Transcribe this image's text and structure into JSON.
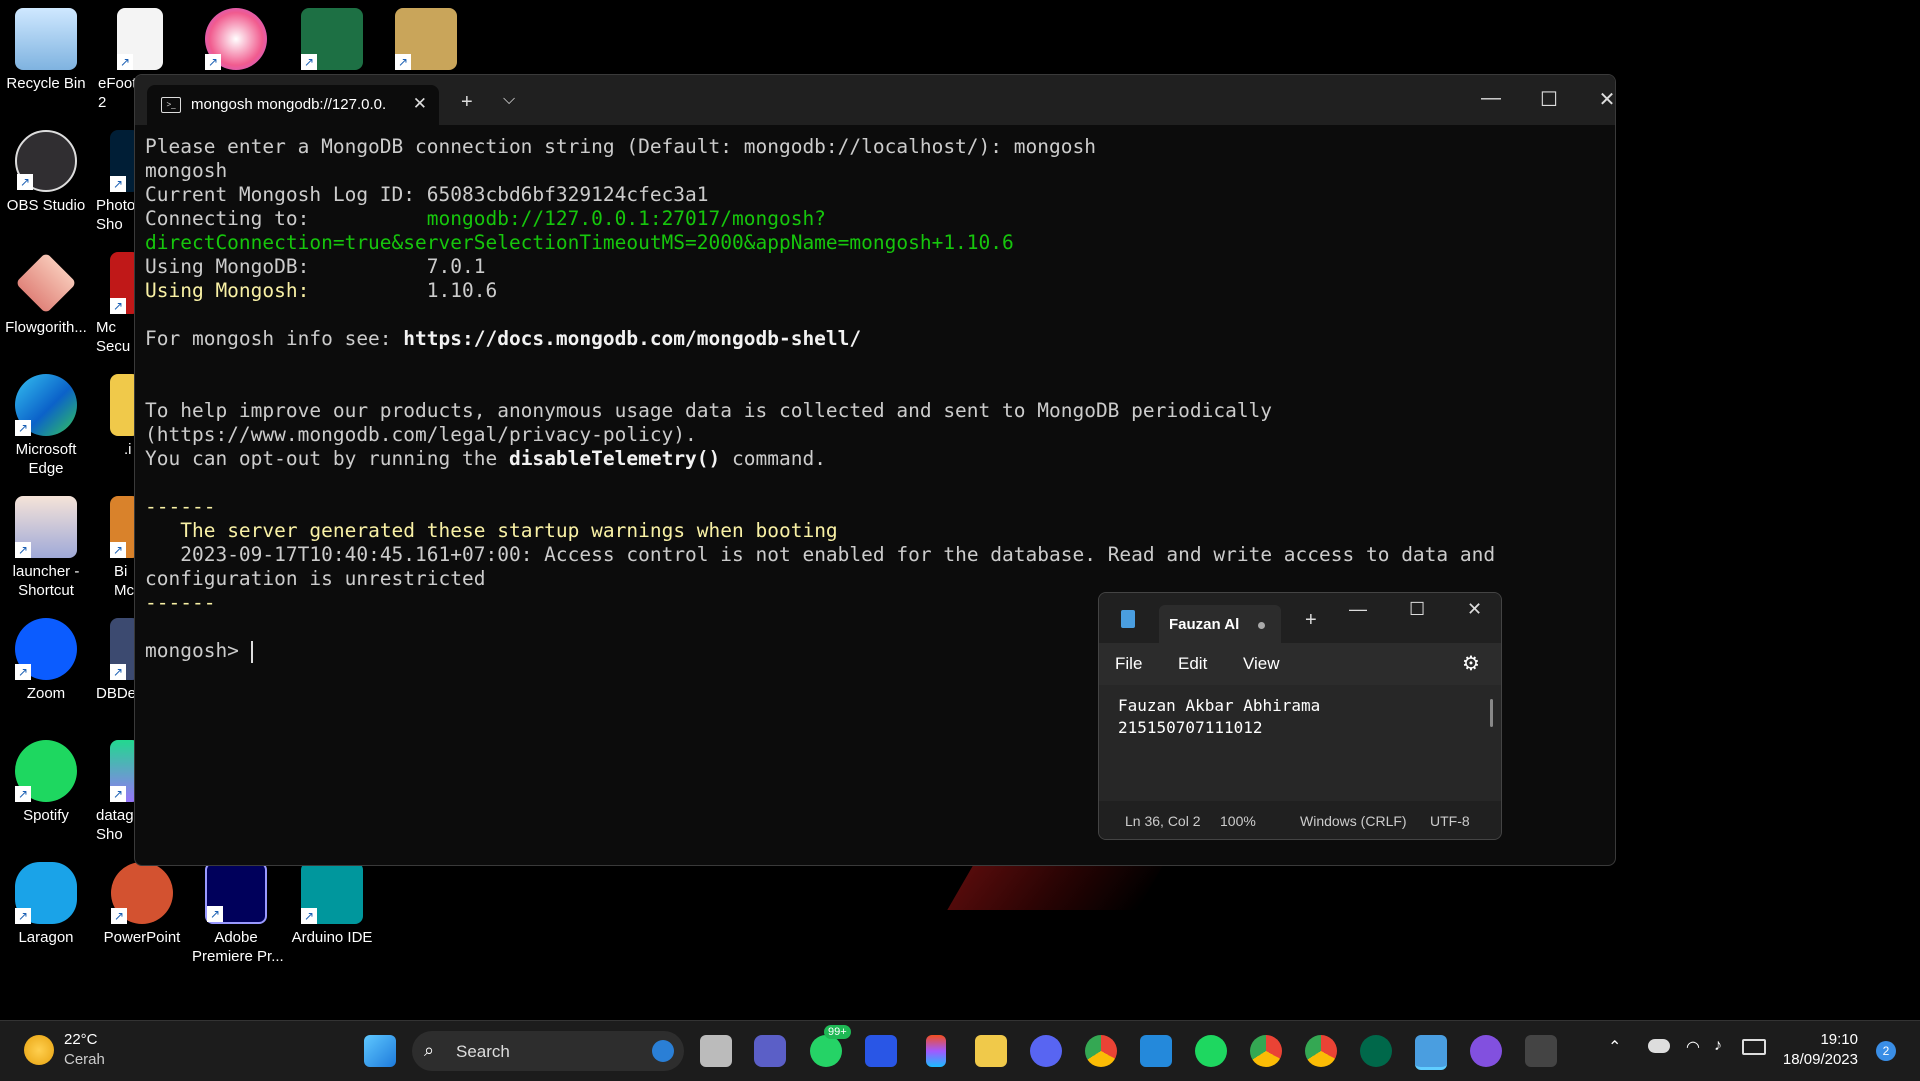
{
  "desktop_icons": [
    {
      "label": "Recycle Bin",
      "icon": "recycle-bin-icon"
    },
    {
      "label": "eFootl\n2",
      "icon": "file-icon"
    },
    {
      "label": "",
      "icon": "itunes-icon"
    },
    {
      "label": "",
      "icon": "excel-icon"
    },
    {
      "label": "",
      "icon": "network-search-icon"
    },
    {
      "label": "OBS Studio",
      "icon": "obs-icon"
    },
    {
      "label": "Photo\nSho",
      "icon": "photoshop-icon"
    },
    {
      "label": "Flowgorith...",
      "icon": "flowgorithm-icon"
    },
    {
      "label": "Mc\nSecu",
      "icon": "mcafee-icon"
    },
    {
      "label": "Microsoft\nEdge",
      "icon": "edge-icon"
    },
    {
      "label": ".i",
      "icon": "folder-icon"
    },
    {
      "label": "launcher -\nShortcut",
      "icon": "launcher-icon"
    },
    {
      "label": "Bi\nMc",
      "icon": "app-icon"
    },
    {
      "label": "Zoom",
      "icon": "zoom-icon"
    },
    {
      "label": "DBDe",
      "icon": "dbdesigner-icon"
    },
    {
      "label": "Spotify",
      "icon": "spotify-icon"
    },
    {
      "label": "datag\nSho",
      "icon": "datagrip-icon"
    },
    {
      "label": "Laragon",
      "icon": "laragon-icon"
    },
    {
      "label": "PowerPoint",
      "icon": "powerpoint-icon"
    },
    {
      "label": "Adobe\nPremiere Pr...",
      "icon": "premiere-icon"
    },
    {
      "label": "Arduino IDE",
      "icon": "arduino-icon"
    }
  ],
  "terminal": {
    "tab_title": "mongosh mongodb://127.0.0.",
    "new_tab": "+",
    "dropdown": "⌵",
    "minimize": "—",
    "maximize": "☐",
    "close": "✕",
    "lines": {
      "l1": "Please enter a MongoDB connection string (Default: mongodb://localhost/): mongosh",
      "l2": "mongosh",
      "l3": "Current Mongosh Log ID: 65083cbd6bf329124cfec3a1",
      "l4_label": "Connecting to:          ",
      "l4_url": "mongodb://127.0.0.1:27017/mongosh?directConnection=true&serverSelectionTimeoutMS=2000&appName=mongosh+1.10.6",
      "l5_label": "Using MongoDB:          ",
      "l5_val": "7.0.1",
      "l6_label": "Using Mongosh:",
      "l6_val": "          1.10.6",
      "l7_prefix": "For mongosh info see: ",
      "l7_link": "https://docs.mongodb.com/mongodb-shell/",
      "l8": "To help improve our products, anonymous usage data is collected and sent to MongoDB periodically (https://www.mongodb.com/legal/privacy-policy).",
      "l9_prefix": "You can opt-out by running the ",
      "l9_cmd": "disableTelemetry()",
      "l9_suffix": " command.",
      "sep": "------",
      "warn_title": "   The server generated these startup warnings when booting",
      "warn_body": "   2023-09-17T10:40:45.161+07:00: Access control is not enabled for the database. Read and write access to data and configuration is unrestricted",
      "prompt": "mongosh> "
    }
  },
  "notepad": {
    "tab_title": "Fauzan Al",
    "new_tab": "+",
    "menu": {
      "file": "File",
      "edit": "Edit",
      "view": "View"
    },
    "content_line1": "Fauzan Akbar Abhirama",
    "content_line2": "215150707111012",
    "status": {
      "position": "Ln 36, Col 2",
      "zoom": "100%",
      "eol": "Windows (CRLF)",
      "encoding": "UTF-8"
    }
  },
  "taskbar": {
    "weather_temp": "22°C",
    "weather_desc": "Cerah",
    "search_placeholder": "Search",
    "whatsapp_badge": "99+",
    "time": "19:10",
    "date": "18/09/2023",
    "notification_count": "2"
  }
}
